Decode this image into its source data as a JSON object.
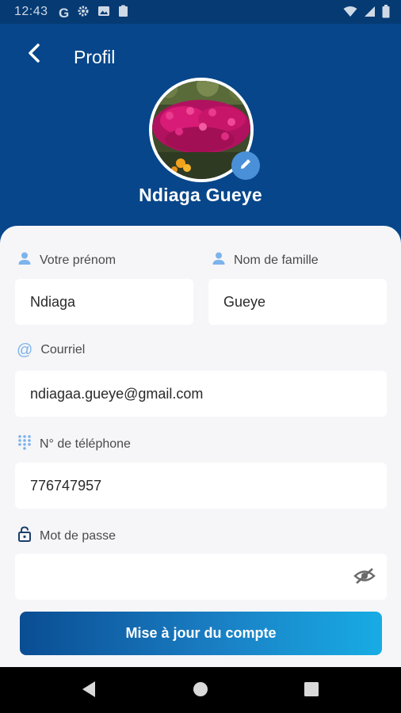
{
  "status_bar": {
    "time": "12:43",
    "left_icons": [
      "google-icon",
      "gear-icon",
      "image-icon",
      "clipboard-icon"
    ],
    "right_icons": [
      "wifi-icon",
      "signal-icon",
      "battery-icon"
    ]
  },
  "header": {
    "title": "Profil",
    "back_icon": "chevron-left-icon",
    "username": "Ndiaga Gueye",
    "edit_icon": "pencil-icon"
  },
  "form": {
    "first_name": {
      "label": "Votre prénom",
      "value": "Ndiaga",
      "icon": "person-icon"
    },
    "last_name": {
      "label": "Nom de famille",
      "value": "Gueye",
      "icon": "person-icon"
    },
    "email": {
      "label": "Courriel",
      "value": "ndiagaa.gueye@gmail.com",
      "icon": "at-icon"
    },
    "phone": {
      "label": "N° de téléphone",
      "value": "776747957",
      "icon": "dialpad-icon"
    },
    "password": {
      "label": "Mot de passe",
      "value": "",
      "icon": "lock-icon",
      "toggle_icon": "eye-off-icon"
    }
  },
  "submit": {
    "label": "Mise à jour du compte"
  },
  "nav": {
    "items": [
      "back-triangle-icon",
      "home-circle-icon",
      "recents-square-icon"
    ]
  },
  "colors": {
    "header_bg": "#07468a",
    "card_bg": "#f6f6f8",
    "accent": "#4a90d9",
    "button_gradient_start": "#0a4d93",
    "button_gradient_end": "#18ace4"
  }
}
